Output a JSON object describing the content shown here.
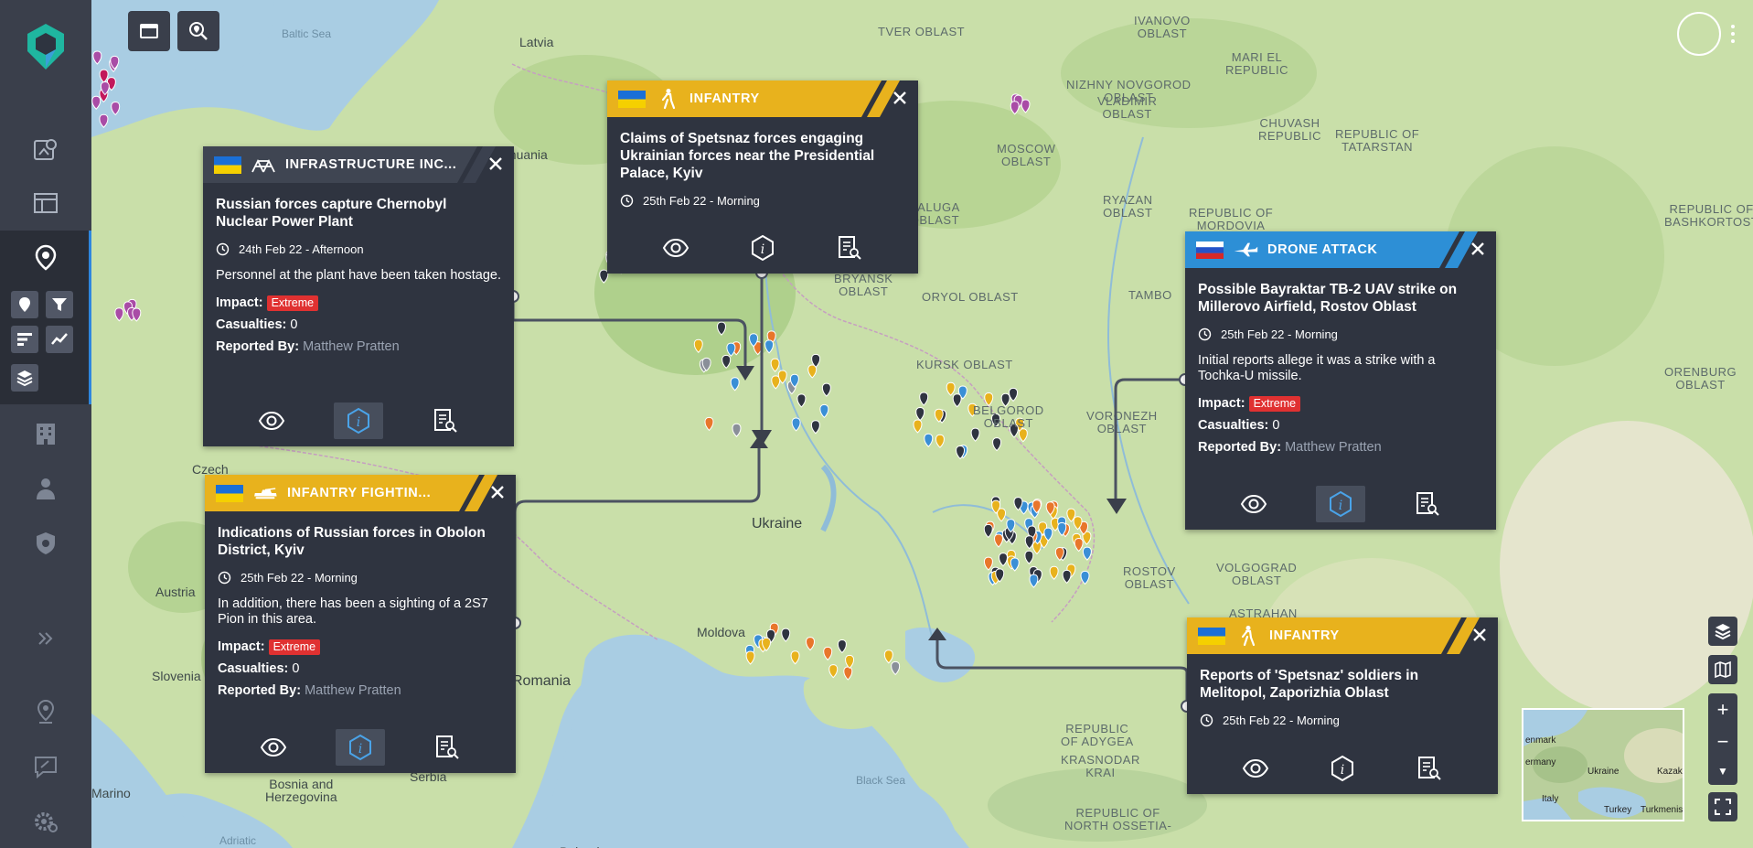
{
  "map": {
    "labels": [
      {
        "text": "Baltic Sea",
        "kind": "sea"
      },
      {
        "text": "Latvia",
        "kind": "country"
      },
      {
        "text": "Lithuania",
        "kind": "country"
      },
      {
        "text": "TVER OBLAST",
        "kind": "region"
      },
      {
        "text": "IVANOVO\nOBLAST",
        "kind": "region"
      },
      {
        "text": "MARI EL\nREPUBLIC",
        "kind": "region"
      },
      {
        "text": "NIZHNY NOVGOROD\nOBLAST",
        "kind": "region"
      },
      {
        "text": "VLADIMIR\nOBLAST",
        "kind": "region"
      },
      {
        "text": "CHUVASH\nREPUBLIC",
        "kind": "region"
      },
      {
        "text": "REPUBLIC OF\nTATARSTAN",
        "kind": "region"
      },
      {
        "text": "MOSCOW\nOBLAST",
        "kind": "region"
      },
      {
        "text": "KALUGA\nOBLAST",
        "kind": "region"
      },
      {
        "text": "RYAZAN\nOBLAST",
        "kind": "region"
      },
      {
        "text": "REPUBLIC OF\nMORDOVIA",
        "kind": "region"
      },
      {
        "text": "REPUBLIC OF\nBASHKORTOST",
        "kind": "region"
      },
      {
        "text": "BRYANSK\nOBLAST",
        "kind": "region"
      },
      {
        "text": "ORYOL OBLAST",
        "kind": "region"
      },
      {
        "text": "TAMBO",
        "kind": "region"
      },
      {
        "text": "KURSK OBLAST",
        "kind": "region"
      },
      {
        "text": "BELGOROD\nOBLAST",
        "kind": "region"
      },
      {
        "text": "VORONEZH\nOBLAST",
        "kind": "region"
      },
      {
        "text": "ORENBURG\nOBLAST",
        "kind": "region"
      },
      {
        "text": "Ukraine",
        "kind": "big"
      },
      {
        "text": "Czech",
        "kind": "country"
      },
      {
        "text": "Austria",
        "kind": "country"
      },
      {
        "text": "Slovenia",
        "kind": "country"
      },
      {
        "text": "Moldova",
        "kind": "country"
      },
      {
        "text": "Romania",
        "kind": "big"
      },
      {
        "text": "Bosnia and\nHerzegovina",
        "kind": "country"
      },
      {
        "text": "Serbia",
        "kind": "country"
      },
      {
        "text": "Marino",
        "kind": "country"
      },
      {
        "text": "Adriatic",
        "kind": "sea"
      },
      {
        "text": "Black Sea",
        "kind": "sea"
      },
      {
        "text": "ROSTOV\nOBLAST",
        "kind": "region"
      },
      {
        "text": "VOLGOGRAD\nOBLAST",
        "kind": "region"
      },
      {
        "text": "ASTRAHAN",
        "kind": "region"
      },
      {
        "text": "REPUBLIC\nOF ADYGEA",
        "kind": "region"
      },
      {
        "text": "KRASNODAR\nKRAI",
        "kind": "region"
      },
      {
        "text": "REPUBLIC OF\nNORTH OSSETIA-",
        "kind": "region"
      },
      {
        "text": "Bulgaria",
        "kind": "country"
      }
    ]
  },
  "popups": [
    {
      "flag": "ukraine",
      "type": "INFRASTRUCTURE INC...",
      "type_icon": "infrastructure-icon",
      "header_color": "#3a3f4b",
      "band_color": "#3f4552",
      "title": "Russian forces capture Chernobyl Nuclear Power Plant",
      "date": "24th Feb 22 - Afternoon",
      "description": "Personnel at the plant have been taken hostage.",
      "impact_label": "Impact:",
      "impact": "Extreme",
      "casualties_label": "Casualties:",
      "casualties": "0",
      "reported_label": "Reported By:",
      "reported_by": "Matthew Pratten",
      "selected_action": "info"
    },
    {
      "flag": "ukraine",
      "type": "INFANTRY",
      "type_icon": "infantry-icon",
      "header_color": "#e8b21d",
      "title": "Claims of Spetsnaz forces engaging Ukrainian forces near the Presidential Palace, Kyiv",
      "date": "25th Feb 22 - Morning",
      "selected_action": ""
    },
    {
      "flag": "russia",
      "type": "DRONE ATTACK",
      "type_icon": "drone-icon",
      "header_color": "#2d8fd6",
      "title": "Possible Bayraktar TB-2 UAV strike on Millerovo Airfield, Rostov Oblast",
      "date": "25th Feb 22 - Morning",
      "description": "Initial reports allege it was a strike with a Tochka-U missile.",
      "impact_label": "Impact:",
      "impact": "Extreme",
      "casualties_label": "Casualties:",
      "casualties": "0",
      "reported_label": "Reported By:",
      "reported_by": "Matthew Pratten",
      "selected_action": "info"
    },
    {
      "flag": "ukraine",
      "type": "INFANTRY FIGHTIN...",
      "type_icon": "ifv-icon",
      "header_color": "#e8b21d",
      "title": "Indications of Russian forces in Obolon District, Kyiv",
      "date": "25th Feb 22 - Morning",
      "description": "In addition, there has been a sighting of a 2S7 Pion in this area.",
      "impact_label": "Impact:",
      "impact": "Extreme",
      "casualties_label": "Casualties:",
      "casualties": "0",
      "reported_label": "Reported By:",
      "reported_by": "Matthew Pratten",
      "selected_action": "info"
    },
    {
      "flag": "ukraine",
      "type": "INFANTRY",
      "type_icon": "infantry-icon",
      "header_color": "#e8b21d",
      "title": "Reports of 'Spetsnaz' soldiers in Melitopol, Zaporizhia Oblast",
      "date": "25th Feb 22 - Morning",
      "selected_action": ""
    }
  ],
  "minimap": {
    "labels": [
      "enmark",
      "ermany",
      "Ukraine",
      "Kazak",
      "Italy",
      "Turkey",
      "Turkmenist"
    ]
  },
  "colors": {
    "sidebar": "#3a3f4b",
    "accent": "#2e86de",
    "infantry": "#e8b21d",
    "drone": "#2d8fd6",
    "extreme": "#e03131",
    "land": "#c6dca6",
    "sea": "#a8cbe0"
  }
}
